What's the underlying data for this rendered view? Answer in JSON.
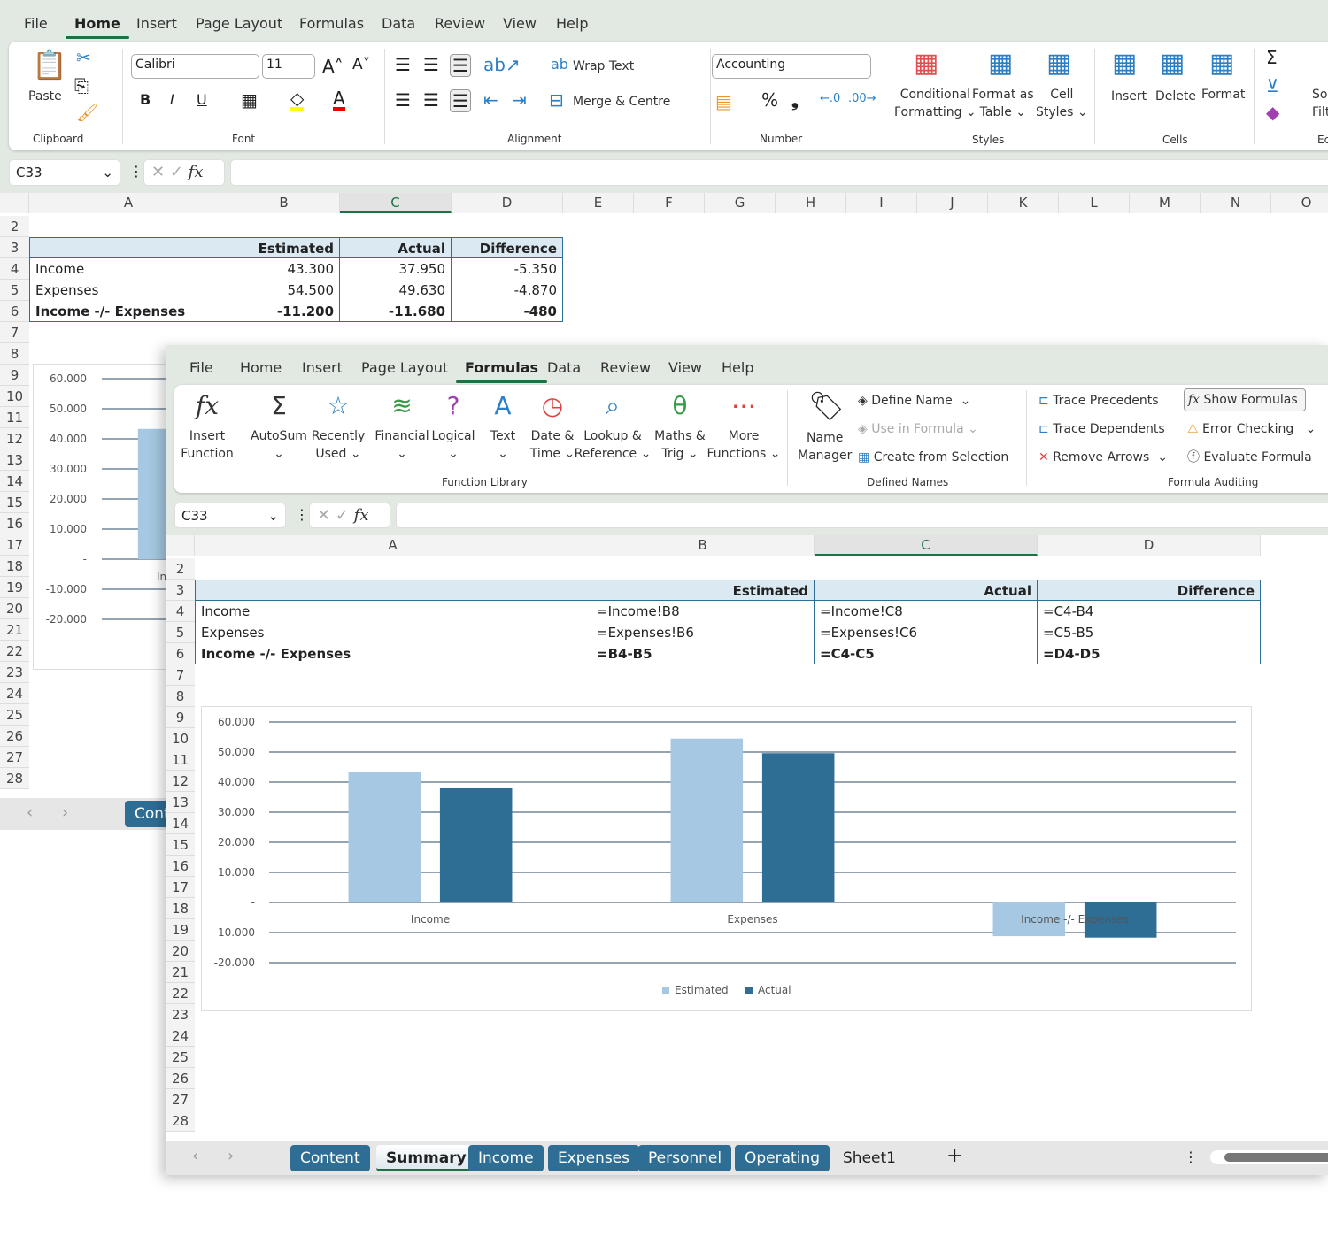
{
  "back_window": {
    "menu": [
      "File",
      "Home",
      "Insert",
      "Page Layout",
      "Formulas",
      "Data",
      "Review",
      "View",
      "Help"
    ],
    "active_menu": "Home",
    "clipboard": {
      "paste": "Paste",
      "group": "Clipboard"
    },
    "font": {
      "name": "Calibri",
      "size": "11",
      "group": "Font",
      "bold": "B",
      "italic": "I",
      "underline": "U"
    },
    "alignment": {
      "wrap": "Wrap Text",
      "merge": "Merge & Centre",
      "group": "Alignment"
    },
    "number": {
      "format": "Accounting",
      "group": "Number",
      "percent": "%",
      "comma": "❟"
    },
    "styles": {
      "cond1": "Conditional",
      "cond2": "Formatting ⌄",
      "fmt1": "Format as",
      "fmt2": "Table ⌄",
      "cell1": "Cell",
      "cell2": "Styles ⌄",
      "group": "Styles"
    },
    "cells": {
      "insert": "Insert",
      "delete": "Delete",
      "format": "Format",
      "group": "Cells"
    },
    "editing": {
      "sort1": "So",
      "sort2": "Filt",
      "group": "Ec"
    },
    "name_box": "C33",
    "columns": [
      "A",
      "B",
      "C",
      "D",
      "E",
      "F",
      "G",
      "H",
      "I",
      "J",
      "K",
      "L",
      "M",
      "N",
      "O"
    ],
    "rows": [
      "2",
      "3",
      "4",
      "5",
      "6",
      "7",
      "8",
      "9",
      "10",
      "11",
      "12",
      "13",
      "14",
      "15",
      "16",
      "17",
      "18",
      "19",
      "20",
      "21",
      "22",
      "23",
      "24",
      "25",
      "26",
      "27",
      "28"
    ],
    "table": {
      "headers": [
        "",
        "Estimated",
        "Actual",
        "Difference"
      ],
      "rows": [
        [
          "Income",
          "43.300",
          "37.950",
          "-5.350"
        ],
        [
          "Expenses",
          "54.500",
          "49.630",
          "-4.870"
        ],
        [
          "Income -/- Expenses",
          "-11.200",
          "-11.680",
          "-480"
        ]
      ]
    },
    "chart_label_partial": "In",
    "sheet_tab_partial": "Cont"
  },
  "front_window": {
    "menu": [
      "File",
      "Home",
      "Insert",
      "Page Layout",
      "Formulas",
      "Data",
      "Review",
      "View",
      "Help"
    ],
    "active_menu": "Formulas",
    "function_library": {
      "items": [
        [
          "Insert",
          "Function"
        ],
        [
          "AutoSum",
          "⌄"
        ],
        [
          "Recently",
          "Used ⌄"
        ],
        [
          "Financial",
          "⌄"
        ],
        [
          "Logical",
          "⌄"
        ],
        [
          "Text",
          "⌄"
        ],
        [
          "Date &",
          "Time ⌄"
        ],
        [
          "Lookup &",
          "Reference ⌄"
        ],
        [
          "Maths &",
          "Trig ⌄"
        ],
        [
          "More",
          "Functions ⌄"
        ]
      ],
      "group": "Function Library"
    },
    "defined_names": {
      "name_manager": [
        "Name",
        "Manager"
      ],
      "define": "Define Name",
      "use": "Use in Formula",
      "create": "Create from Selection",
      "group": "Defined Names"
    },
    "formula_auditing": {
      "trace_prec": "Trace Precedents",
      "trace_dep": "Trace Dependents",
      "remove": "Remove Arrows",
      "show": "Show Formulas",
      "error": "Error Checking",
      "evaluate": "Evaluate Formula",
      "group": "Formula Auditing"
    },
    "name_box": "C33",
    "columns": [
      "A",
      "B",
      "C",
      "D"
    ],
    "rows": [
      "2",
      "3",
      "4",
      "5",
      "6",
      "7",
      "8",
      "9",
      "10",
      "11",
      "12",
      "13",
      "14",
      "15",
      "16",
      "17",
      "18",
      "19",
      "20",
      "21",
      "22",
      "23",
      "24",
      "25",
      "26",
      "27",
      "28"
    ],
    "table": {
      "headers": [
        "",
        "Estimated",
        "Actual",
        "Difference"
      ],
      "rows": [
        [
          "Income",
          "=Income!B8",
          "=Income!C8",
          "=C4-B4"
        ],
        [
          "Expenses",
          "=Expenses!B6",
          "=Expenses!C6",
          "=C5-B5"
        ],
        [
          "Income -/- Expenses",
          "=B4-B5",
          "=C4-C5",
          "=D4-D5"
        ]
      ]
    },
    "sheet_tabs": [
      "Content",
      "Summary",
      "Income",
      "Expenses",
      "Personnel",
      "Operating",
      "Sheet1"
    ],
    "active_sheet": "Summary"
  },
  "chart_data": {
    "type": "bar",
    "categories": [
      "Income",
      "Expenses",
      "Income -/- Expenses"
    ],
    "series": [
      {
        "name": "Estimated",
        "values": [
          43300,
          54500,
          -11200
        ],
        "color": "#a6c8e2"
      },
      {
        "name": "Actual",
        "values": [
          37950,
          49630,
          -11680
        ],
        "color": "#2e6e95"
      }
    ],
    "ylim": [
      -20000,
      60000
    ],
    "yticks": [
      60000,
      50000,
      40000,
      30000,
      20000,
      10000,
      0,
      -10000,
      -20000
    ],
    "ytick_labels": [
      "60.000",
      "50.000",
      "40.000",
      "30.000",
      "20.000",
      "10.000",
      "-",
      "-10.000",
      "-20.000"
    ],
    "grid": true,
    "legend": "bottom"
  },
  "colors": {
    "accent": "#1e7145",
    "tab": "#2e6e95",
    "header_fill": "#dbe9f3",
    "table_border": "#2e6e95"
  }
}
